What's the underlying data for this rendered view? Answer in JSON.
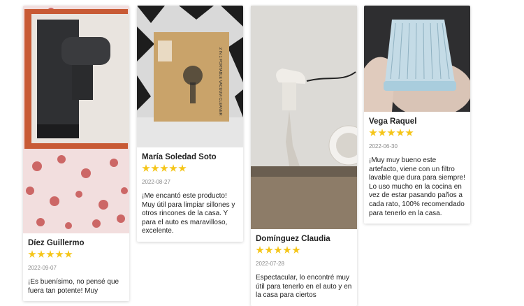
{
  "reviews": [
    {
      "author": "Díez Guillermo",
      "rating": 5,
      "date": "2022-09-07",
      "text": "¡Es buenísimo, no pensé que fuera tan potente! Muy"
    },
    {
      "author": "María Soledad Soto",
      "rating": 5,
      "date": "2022-08-27",
      "text": "¡Me encantó este producto! Muy útil para limpiar sillones y otros rincones de la casa. Y para el auto es maravilloso, excelente.",
      "photo_label": "2 IN 1 PORTABLE VACUUM CLEANER"
    },
    {
      "author": "Domínguez Claudia",
      "rating": 5,
      "date": "2022-07-28",
      "text": "Espectacular, lo encontré muy útil para tenerlo en el auto y en la casa para ciertos"
    },
    {
      "author": "Vega Raquel",
      "rating": 5,
      "date": "2022-06-30",
      "text": "¡Muy muy bueno este artefacto, viene con un filtro lavable que dura para siempre! Lo uso mucho en la cocina en vez de estar pasando paños a cada rato, 100% recomendado para tenerlo en la casa."
    }
  ],
  "colors": {
    "star": "#f5c518",
    "date": "#8a8a8a",
    "text": "#222222"
  }
}
